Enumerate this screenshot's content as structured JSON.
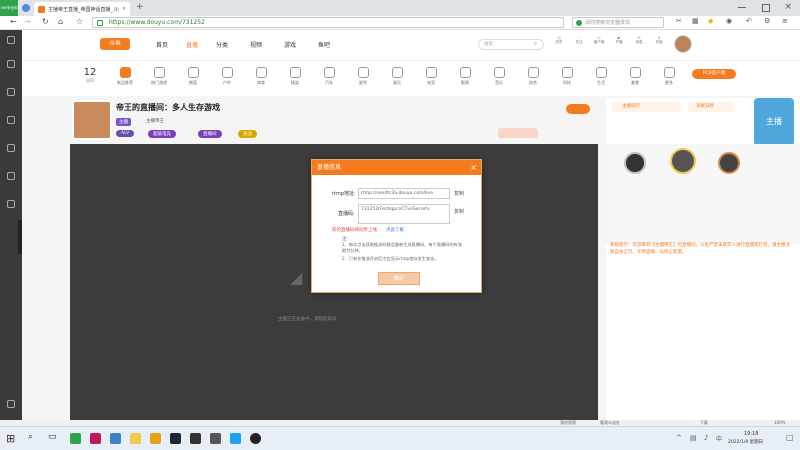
{
  "browser": {
    "badge": "360安全浏览器",
    "tabs": [
      {
        "title": "主播帝王直播_帝国神话直播_斗鱼"
      }
    ],
    "new_tab": "+",
    "url": "https://www.douyu.com/731252",
    "url_host": "www.douyu.com",
    "search_placeholder": "请你搜索浏览器发现"
  },
  "site": {
    "nav": [
      "首页",
      "直播",
      "分类",
      "视频",
      "游戏",
      "鱼吧"
    ],
    "search_placeholder": "搜索",
    "user_icons": [
      "历史",
      "关注",
      "客户端",
      "开播",
      "消息",
      "充值",
      "任务"
    ],
    "categories": [
      "12",
      "新品推荐",
      "热门游戏",
      "颜值",
      "户外",
      "体育",
      "搞笑",
      "汽车",
      "星秀",
      "娱乐",
      "电竞",
      "影视",
      "音乐",
      "综合",
      "科技",
      "生活",
      "美食",
      "新游",
      "更多"
    ],
    "cat_date": "12",
    "cat_date_sub": "周四",
    "promo": "PCB客户端",
    "room": {
      "title": "帝王的直播间：多人生存游戏",
      "tag": "主播",
      "streamer": "主播帝王",
      "pill1": "超级电竞",
      "pill2": "直播间",
      "pill3": "关注"
    },
    "right_tabs": [
      "主播排行",
      "贡献日榜"
    ],
    "overlay_text": "主播正在准备中，请稍后再试",
    "notice": "系统提示：欢迎来到【主播帝王】的直播间。斗鱼严禁未成年人进行直播或打赏，请主播注意自身言行，文明直播，弘扬正能量。",
    "bottom_bar": [
      "我的视频",
      "看观众送礼",
      "用户关注",
      "下载",
      "斗鱼客户端"
    ]
  },
  "modal": {
    "title": "直播信息",
    "close": "×",
    "rtmp_label": "rtmp地址:",
    "rtmp_value": "rtmp://sendtc3a.douyu.com/live",
    "copy1": "复制",
    "key_label": "直播码:",
    "key_value": "731252rFezhqpcnCTvoSecretv",
    "copy2": "复制",
    "warning": "新的直播码将同步上线",
    "link": "点此了解",
    "notes_head": "注:",
    "note1": "1、每次点击获取推流码都会重新生成直播码，每个直播码的有效期为分钟。",
    "note2": "2、只有在推流开启后才会显示rtmp地址发生变化。",
    "confirm": "确定"
  },
  "taskbar": {
    "time": "19:18",
    "date": "2022/1/9 星期日",
    "zoom": "100%"
  }
}
